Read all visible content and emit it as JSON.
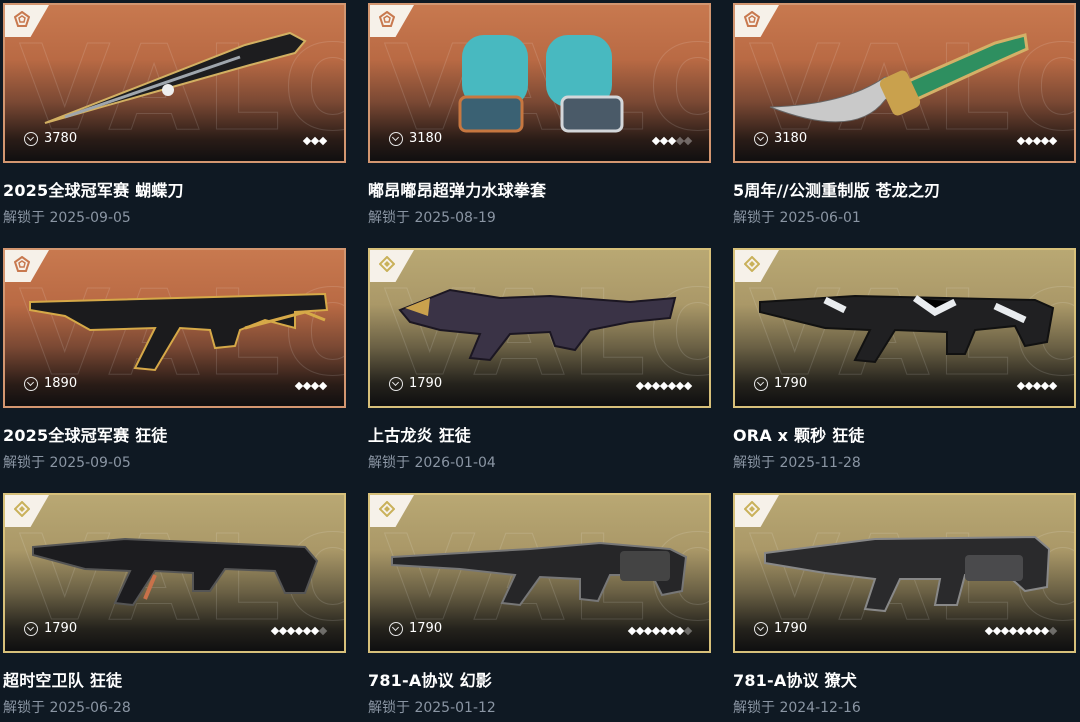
{
  "watermark": "VALORANT",
  "items": [
    {
      "name": "2025全球冠军赛 蝴蝶刀",
      "unlock_prefix": "解锁于",
      "date": "2025-09-05",
      "price": "3780",
      "tier": "orange",
      "dots": [
        1,
        1,
        1
      ],
      "art": "knife"
    },
    {
      "name": "嘟昂嘟昂超弹力水球拳套",
      "unlock_prefix": "解锁于",
      "date": "2025-08-19",
      "price": "3180",
      "tier": "orange",
      "dots": [
        1,
        1,
        1,
        0,
        0
      ],
      "art": "gloves"
    },
    {
      "name": "5周年//公测重制版 苍龙之刃",
      "unlock_prefix": "解锁于",
      "date": "2025-06-01",
      "price": "3180",
      "tier": "orange",
      "dots": [
        1,
        1,
        1,
        1,
        1
      ],
      "art": "dagger"
    },
    {
      "name": "2025全球冠军赛 狂徒",
      "unlock_prefix": "解锁于",
      "date": "2025-09-05",
      "price": "1890",
      "tier": "orange",
      "dots": [
        1,
        1,
        1,
        1
      ],
      "art": "vandal-gold"
    },
    {
      "name": "上古龙炎 狂徒",
      "unlock_prefix": "解锁于",
      "date": "2026-01-04",
      "price": "1790",
      "tier": "gold",
      "dots": [
        1,
        1,
        1,
        1,
        1,
        1,
        1
      ],
      "art": "vandal-dragon"
    },
    {
      "name": "ORA x 颗秒 狂徒",
      "unlock_prefix": "解锁于",
      "date": "2025-11-28",
      "price": "1790",
      "tier": "gold",
      "dots": [
        1,
        1,
        1,
        1,
        1
      ],
      "art": "vandal-white"
    },
    {
      "name": "超时空卫队 狂徒",
      "unlock_prefix": "解锁于",
      "date": "2025-06-28",
      "price": "1790",
      "tier": "gold",
      "dots": [
        1,
        1,
        1,
        1,
        1,
        1,
        0
      ],
      "art": "vandal-dark"
    },
    {
      "name": "781-A协议 幻影",
      "unlock_prefix": "解锁于",
      "date": "2025-01-12",
      "price": "1790",
      "tier": "gold",
      "dots": [
        1,
        1,
        1,
        1,
        1,
        1,
        1,
        0
      ],
      "art": "phantom"
    },
    {
      "name": "781-A协议 獠犬",
      "unlock_prefix": "解锁于",
      "date": "2024-12-16",
      "price": "1790",
      "tier": "gold",
      "dots": [
        1,
        1,
        1,
        1,
        1,
        1,
        1,
        1,
        0
      ],
      "art": "rifle"
    }
  ]
}
